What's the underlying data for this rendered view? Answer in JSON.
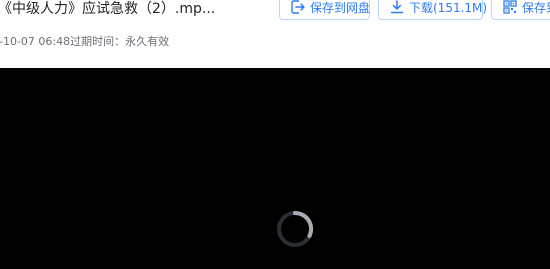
{
  "file": {
    "title": "《中级人力》应试急救（2）.mp...",
    "meta": "-10-07 06:48过期时间：永久有效"
  },
  "toolbar": {
    "save_label": "保存到网盘",
    "download_label": "下载(151.1M)",
    "save_qr_label": "保存到"
  },
  "icons": {
    "save": "save-to-drive-icon",
    "download": "download-icon",
    "qr": "qr-code-icon",
    "loading": "loading-spinner-icon"
  },
  "colors": {
    "accent": "#2d7bf4",
    "button_border": "#b9d3ff",
    "player_bg": "#000000",
    "text": "#1f2329",
    "meta_text": "#6b6f76"
  }
}
